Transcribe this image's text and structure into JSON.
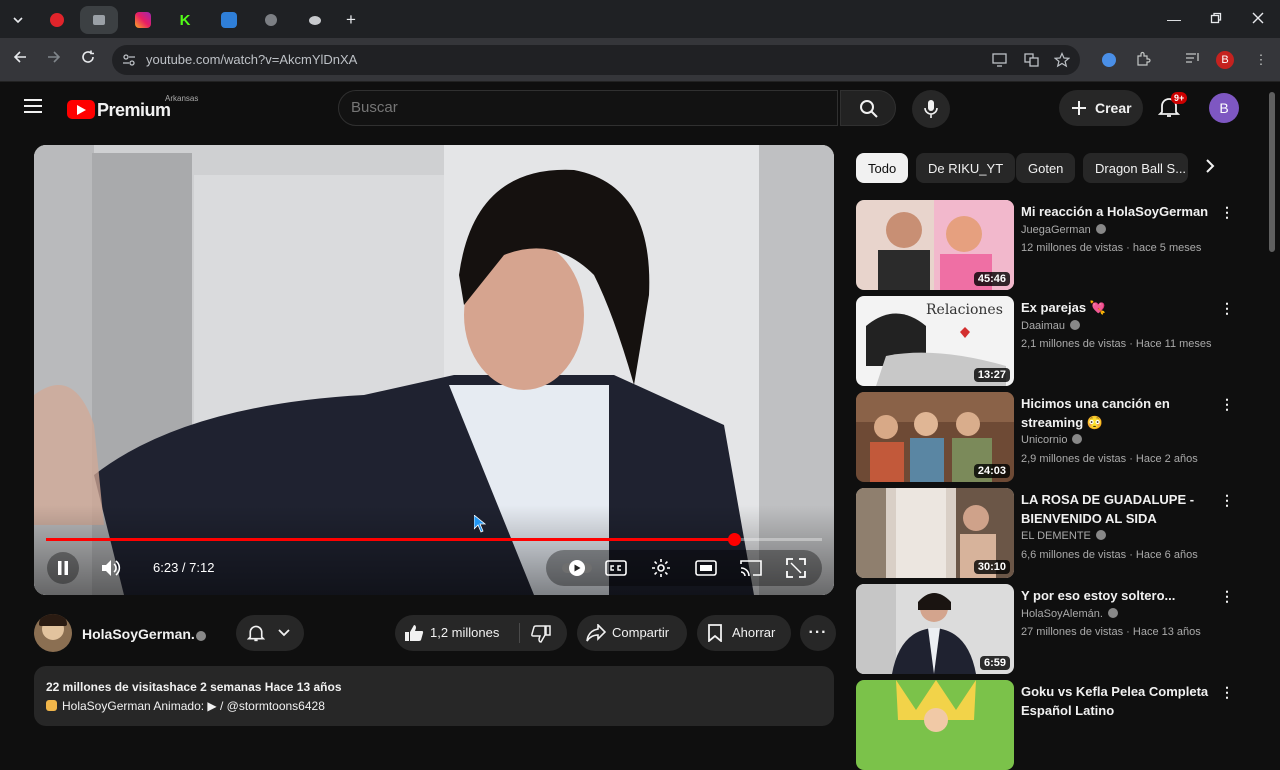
{
  "browser": {
    "url": "youtube.com/watch?v=AkcmYlDnXA"
  },
  "youtube": {
    "logo_text": "Premium",
    "logo_country": "Arkansas",
    "search_placeholder": "Buscar",
    "create_label": "Crear",
    "notif_badge": "9+",
    "avatar_letter": "B"
  },
  "player": {
    "time": "6:23 / 7:12",
    "progress": 0.8868
  },
  "video": {
    "channel": "HolaSoyGerman.",
    "likes": "1,2 millones",
    "share_label": "Compartir",
    "save_label": "Ahorrar",
    "desc_line1": "22 millones de visitashace 2 semanas  Hace 13 años",
    "desc_line2": "HolaSoyGerman Animado: ▶ / @stormtoons6428"
  },
  "chips": [
    "Todo",
    "De RIKU_YT",
    "Goten",
    "Dragon Ball S..."
  ],
  "recommendations": [
    {
      "title": "Mi reacción a HolaSoyGerman",
      "channel": "JuegaGerman",
      "meta": "12 millones de vistas · hace 5 meses",
      "duration": "45:46"
    },
    {
      "title": "Ex parejas 💘",
      "channel": "Daaimau",
      "meta": "2,1 millones de vistas · Hace 11 meses",
      "duration": "13:27"
    },
    {
      "title": "Hicimos una canción en streaming 😳",
      "channel": "Unicornio",
      "meta": "2,9 millones de vistas · Hace 2 años",
      "duration": "24:03"
    },
    {
      "title": "LA ROSA DE GUADALUPE - BIENVENIDO AL SIDA",
      "channel": "EL DEMENTE",
      "meta": "6,6 millones de vistas · Hace 6 años",
      "duration": "30:10"
    },
    {
      "title": "Y por eso estoy soltero...",
      "channel": "HolaSoyAlemán.",
      "meta": "27 millones de vistas · Hace 13 años",
      "duration": "6:59"
    },
    {
      "title": "Goku vs Kefla Pelea Completa Español Latino",
      "channel": "",
      "meta": "",
      "duration": ""
    }
  ]
}
